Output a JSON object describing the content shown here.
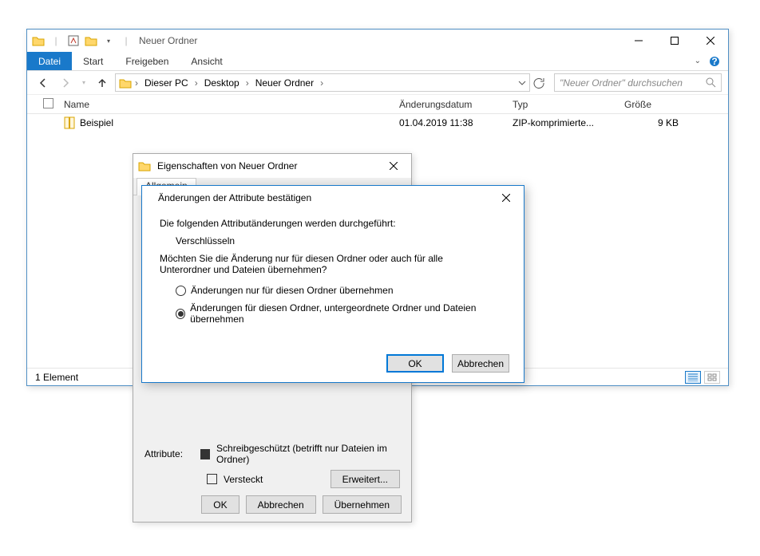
{
  "explorer": {
    "title": "Neuer Ordner",
    "tabs": {
      "datei": "Datei",
      "start": "Start",
      "freigeben": "Freigeben",
      "ansicht": "Ansicht"
    },
    "breadcrumb": [
      "Dieser PC",
      "Desktop",
      "Neuer Ordner"
    ],
    "search_placeholder": "\"Neuer Ordner\" durchsuchen",
    "columns": {
      "name": "Name",
      "date": "Änderungsdatum",
      "type": "Typ",
      "size": "Größe"
    },
    "row": {
      "name": "Beispiel",
      "date": "01.04.2019 11:38",
      "type": "ZIP-komprimierte...",
      "size": "9 KB"
    },
    "status": "1 Element"
  },
  "props": {
    "title": "Eigenschaften von Neuer Ordner",
    "tab_general": "Allgemein",
    "attributes_label": "Attribute:",
    "readonly": "Schreibgeschützt (betrifft nur Dateien im Ordner)",
    "hidden": "Versteckt",
    "advanced": "Erweitert...",
    "ok": "OK",
    "cancel": "Abbrechen",
    "apply": "Übernehmen"
  },
  "confirm": {
    "title": "Änderungen der Attribute bestätigen",
    "line1": "Die folgenden Attributänderungen werden durchgeführt:",
    "change": "Verschlüsseln",
    "line2": "Möchten Sie die Änderung nur für diesen Ordner oder auch für alle Unterordner und Dateien übernehmen?",
    "opt1": "Änderungen nur für diesen Ordner übernehmen",
    "opt2": "Änderungen für diesen Ordner, untergeordnete Ordner und Dateien übernehmen",
    "ok": "OK",
    "cancel": "Abbrechen"
  }
}
